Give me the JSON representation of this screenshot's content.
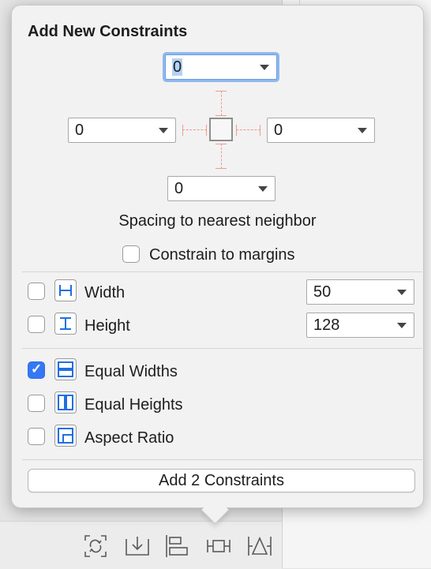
{
  "popover": {
    "title": "Add New Constraints",
    "spacing": {
      "top": "0",
      "left": "0",
      "right": "0",
      "bottom": "0",
      "caption": "Spacing to nearest neighbor"
    },
    "constrain_to_margins": {
      "label": "Constrain to margins",
      "checked": false
    },
    "size": [
      {
        "label": "Width",
        "value": "50",
        "checked": false,
        "icon": "width-constraint-icon"
      },
      {
        "label": "Height",
        "value": "128",
        "checked": false,
        "icon": "height-constraint-icon"
      }
    ],
    "equal": [
      {
        "label": "Equal Widths",
        "checked": true,
        "icon": "equal-widths-icon"
      },
      {
        "label": "Equal Heights",
        "checked": false,
        "icon": "equal-heights-icon"
      },
      {
        "label": "Aspect Ratio",
        "checked": false,
        "icon": "aspect-ratio-icon"
      }
    ],
    "add_button": "Add 2 Constraints"
  },
  "toolbar": {
    "icons": [
      "update-frames-icon",
      "embed-in-icon",
      "align-icon",
      "add-constraints-icon",
      "resolve-issues-icon"
    ]
  },
  "colors": {
    "accent": "#3478f6",
    "constraint_line": "#f19a8a"
  }
}
